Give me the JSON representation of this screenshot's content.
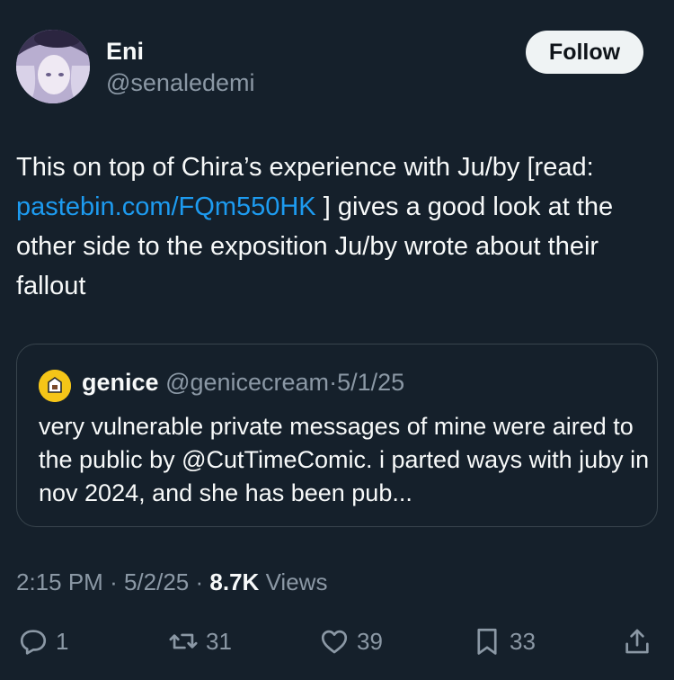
{
  "author": {
    "display_name": "Eni",
    "handle": "@senaledemi",
    "follow_label": "Follow"
  },
  "tweet": {
    "text_before_link": "This on top of Chira’s experience with Ju/by [read: ",
    "link_text": "pastebin.com/FQm550HK",
    "text_after_link": " ] gives a good look at the other side to the exposition Ju/by wrote about their fallout"
  },
  "quote": {
    "display_name": "genice",
    "handle": "@genicecream",
    "separator": "·",
    "date": "5/1/25",
    "text": "very vulnerable private messages of mine were aired to the public by @CutTimeComic. i parted ways with juby in nov 2024, and she has been pub..."
  },
  "meta": {
    "time": "2:15 PM",
    "separator": "·",
    "date": "5/2/25",
    "views_count": "8.7K",
    "views_label": "Views"
  },
  "actions": {
    "replies": "1",
    "reposts": "31",
    "likes": "39",
    "bookmarks": "33"
  },
  "icons": [
    "avatar-image",
    "reply-icon",
    "repost-icon",
    "like-icon",
    "bookmark-icon",
    "share-icon"
  ],
  "colors": {
    "background": "#15202b",
    "text": "#f7f9f9",
    "muted": "#8b98a5",
    "link": "#1d9bf0",
    "border": "#38444d",
    "follow_bg": "#eff3f4"
  }
}
